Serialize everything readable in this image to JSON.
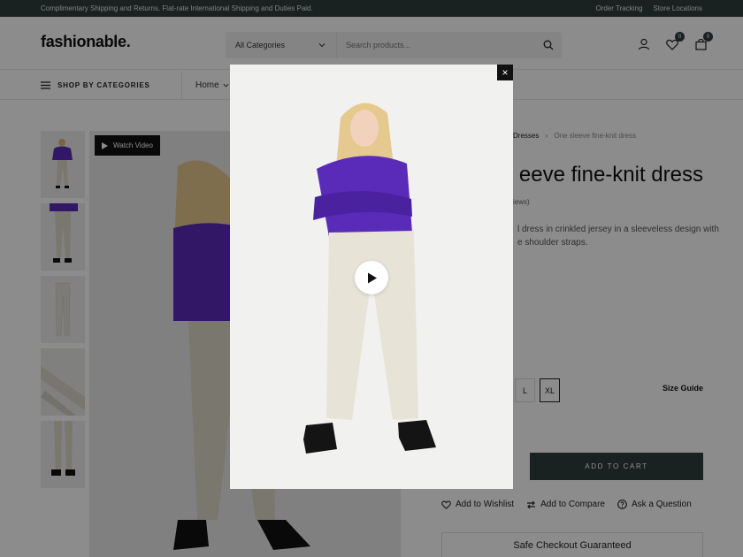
{
  "topbar": {
    "promo": "Complimentary Shipping and Returns. Flat-rate International Shipping and Duties Paid.",
    "links": [
      "Order Tracking",
      "Store Locations"
    ]
  },
  "header": {
    "logo": "fashionable.",
    "category_select": "All Categories",
    "search_placeholder": "Search products...",
    "wishlist_count": "0",
    "cart_count": "0"
  },
  "nav": {
    "shop_by_categories": "SHOP BY CATEGORIES",
    "home": "Home"
  },
  "gallery": {
    "watch_video": "Watch Video"
  },
  "product": {
    "breadcrumb_parent": "Dresses",
    "breadcrumb_sep": "›",
    "breadcrumb_current": "One sleeve fine-knit dress",
    "title_visible": "eeve fine-knit dress",
    "reviews_visible": "iews)",
    "desc_visible": "l dress in crinkled jersey in a sleeveless design with e shoulder straps.",
    "sizes": [
      "L",
      "XL"
    ],
    "selected_size": "XL",
    "size_guide": "Size Guide",
    "add_to_cart": "ADD TO CART",
    "actions": [
      "Add to Wishlist",
      "Add to Compare",
      "Ask a Question"
    ],
    "safe_checkout": "Safe Checkout Guaranteed"
  },
  "modal": {
    "close_glyph": "×"
  },
  "colors": {
    "dark_accent": "#2f3c3c",
    "sweater_purple": "#5a2bb8"
  }
}
